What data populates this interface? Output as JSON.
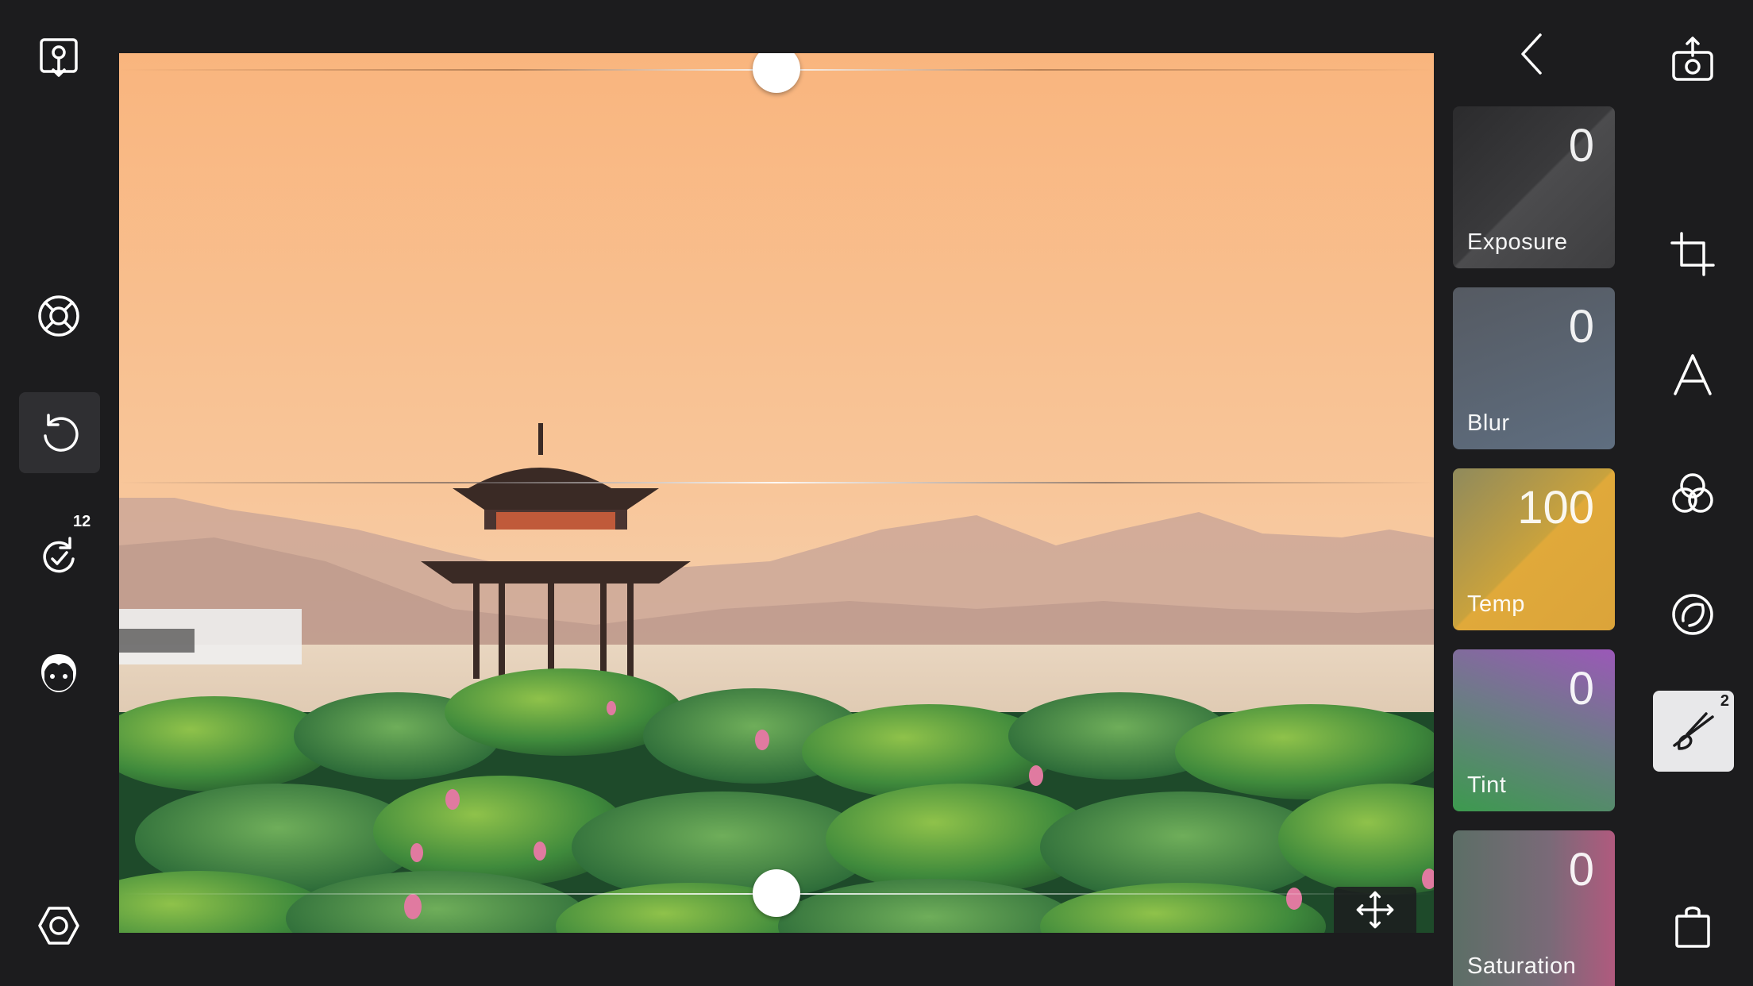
{
  "left_toolbar": {
    "items": [
      {
        "name": "download-icon-button",
        "icon": "location-download-icon"
      },
      {
        "name": "lifebuoy-button",
        "icon": "lifebuoy-icon"
      },
      {
        "name": "undo-button",
        "icon": "undo-icon",
        "active": true
      },
      {
        "name": "redo-button",
        "icon": "redo-icon",
        "badge": "12"
      },
      {
        "name": "face-button",
        "icon": "face-icon"
      },
      {
        "name": "settings-button",
        "icon": "hexagon-settings-icon"
      }
    ]
  },
  "canvas": {
    "sliders": {
      "top": {
        "value": 0.5
      },
      "bottom": {
        "value": 0.5
      }
    },
    "move_icon": "move-arrows-icon"
  },
  "adjustments": {
    "back_icon": "chevron-left-icon",
    "cards": [
      {
        "label": "Exposure",
        "value": "0",
        "colors": [
          "#2e2e30",
          "#4a4a4c"
        ]
      },
      {
        "label": "Blur",
        "value": "0",
        "colors": [
          "#5a6068",
          "#6a7a8c"
        ]
      },
      {
        "label": "Temp",
        "value": "100",
        "colors": [
          "#b39138",
          "#e0a93a"
        ]
      },
      {
        "label": "Tint",
        "value": "0",
        "colors": [
          "#4a9b5a",
          "#9b5ab0"
        ]
      },
      {
        "label": "Saturation",
        "value": "0",
        "colors": [
          "#5a7068",
          "#a75a7a"
        ]
      }
    ]
  },
  "right_toolbar": {
    "items": [
      {
        "name": "share-button",
        "icon": "camera-export-icon"
      },
      {
        "name": "crop-button",
        "icon": "crop-icon"
      },
      {
        "name": "text-button",
        "icon": "text-a-icon"
      },
      {
        "name": "filters-button",
        "icon": "overlap-circles-icon"
      },
      {
        "name": "vignette-button",
        "icon": "ring-icon"
      },
      {
        "name": "brush-button",
        "icon": "brush-strike-icon",
        "badge": "2",
        "active": true
      },
      {
        "name": "store-button",
        "icon": "shopping-bag-icon"
      }
    ]
  }
}
